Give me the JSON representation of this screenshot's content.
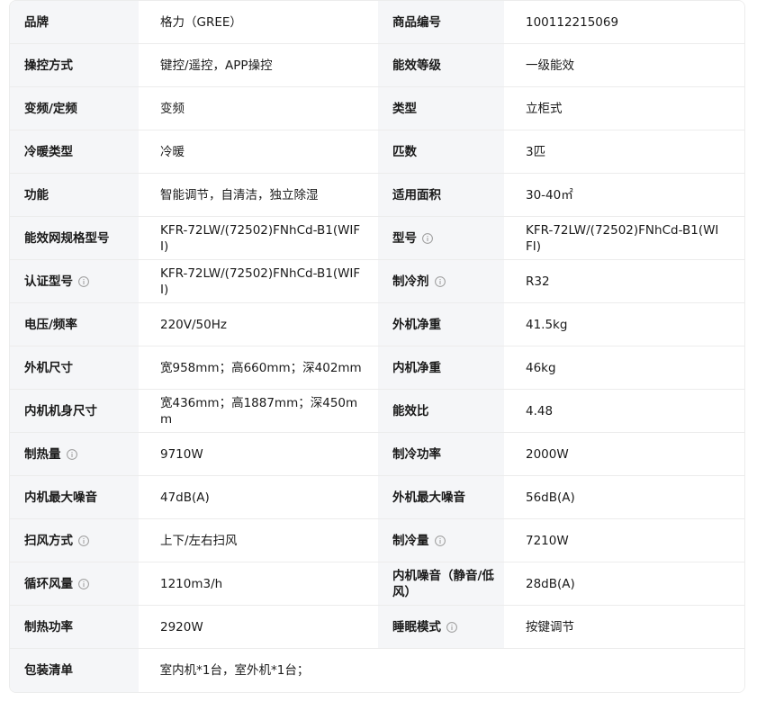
{
  "rows": [
    {
      "l1": "品牌",
      "v1": "格力（GREE）",
      "l2": "商品编号",
      "v2": "100112215069"
    },
    {
      "l1": "操控方式",
      "v1": "键控/遥控，APP操控",
      "l2": "能效等级",
      "v2": "一级能效"
    },
    {
      "l1": "变频/定频",
      "v1": "变频",
      "l2": "类型",
      "v2": "立柜式"
    },
    {
      "l1": "冷暖类型",
      "v1": "冷暖",
      "l2": "匹数",
      "v2": "3匹"
    },
    {
      "l1": "功能",
      "v1": "智能调节，自清洁，独立除湿",
      "l2": "适用面积",
      "v2": "30-40㎡"
    },
    {
      "l1": "能效网规格型号",
      "v1": "KFR-72LW/(72502)FNhCd-B1(WIFI)",
      "l2": "型号",
      "v2": "KFR-72LW/(72502)FNhCd-B1(WIFI)"
    },
    {
      "l1": "认证型号",
      "v1": "KFR-72LW/(72502)FNhCd-B1(WIFI)",
      "l2": "制冷剂",
      "v2": "R32"
    },
    {
      "l1": "电压/频率",
      "v1": "220V/50Hz",
      "l2": "外机净重",
      "v2": "41.5kg"
    },
    {
      "l1": "外机尺寸",
      "v1": "宽958mm；高660mm；深402mm",
      "l2": "内机净重",
      "v2": "46kg"
    },
    {
      "l1": "内机机身尺寸",
      "v1": "宽436mm；高1887mm；深450mm",
      "l2": "能效比",
      "v2": "4.48"
    },
    {
      "l1": "制热量",
      "v1": "9710W",
      "l2": "制冷功率",
      "v2": "2000W"
    },
    {
      "l1": "内机最大噪音",
      "v1": "47dB(A)",
      "l2": "外机最大噪音",
      "v2": "56dB(A)"
    },
    {
      "l1": "扫风方式",
      "v1": "上下/左右扫风",
      "l2": "制冷量",
      "v2": "7210W"
    },
    {
      "l1": "循环风量",
      "v1": "1210m3/h",
      "l2": "内机噪音（静音/低风）",
      "v2": "28dB(A)"
    },
    {
      "l1": "制热功率",
      "v1": "2920W",
      "l2": "睡眠模式",
      "v2": "按键调节"
    }
  ],
  "last_row": {
    "label": "包装清单",
    "value": "室内机*1台，室外机*1台；"
  },
  "icons": {
    "info": "info-circle-icon"
  },
  "colors": {
    "label_bg": "#f5f6f8",
    "border": "#ececec",
    "icon": "#9a9a9a"
  }
}
